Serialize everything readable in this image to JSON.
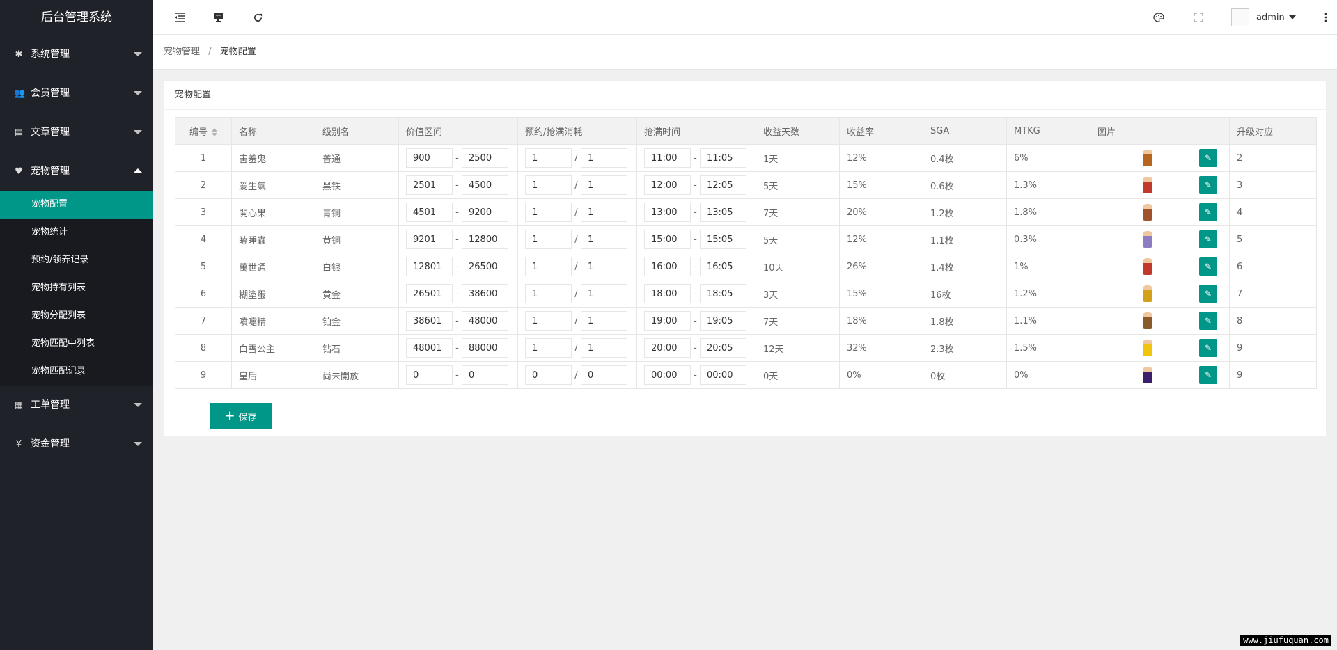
{
  "app_title": "后台管理系统",
  "sidebar": {
    "groups": [
      {
        "label": "系统管理",
        "icon": "gear-icon",
        "glyph": "✱"
      },
      {
        "label": "会员管理",
        "icon": "users-icon",
        "glyph": "👥"
      },
      {
        "label": "文章管理",
        "icon": "copy-icon",
        "glyph": "▤"
      },
      {
        "label": "宠物管理",
        "icon": "heart-icon",
        "glyph": "♥"
      },
      {
        "label": "工单管理",
        "icon": "file-icon",
        "glyph": "▦"
      },
      {
        "label": "资金管理",
        "icon": "yen-icon",
        "glyph": "¥"
      }
    ],
    "pet_sub": [
      {
        "label": "宠物配置",
        "active": true
      },
      {
        "label": "宠物统计"
      },
      {
        "label": "预约/领养记录"
      },
      {
        "label": "宠物持有列表"
      },
      {
        "label": "宠物分配列表"
      },
      {
        "label": "宠物匹配中列表"
      },
      {
        "label": "宠物匹配记录"
      }
    ]
  },
  "header": {
    "user": "admin",
    "icons": [
      "menu-shrink-icon",
      "monitor-icon",
      "refresh-icon",
      "theme-icon",
      "fullscreen-icon",
      "more-icon"
    ]
  },
  "breadcrumb": {
    "parent": "宠物管理",
    "current": "宠物配置",
    "sep": "/"
  },
  "card": {
    "title": "宠物配置"
  },
  "table": {
    "headers": [
      "编号",
      "名称",
      "级别名",
      "价值区间",
      "预约/抢满消耗",
      "抢满时间",
      "收益天数",
      "收益率",
      "SGA",
      "MTKG",
      "图片",
      "升级对应"
    ],
    "rows": [
      {
        "id": "1",
        "name": "害羞鬼",
        "level": "普通",
        "vmin": "900",
        "vmax": "2500",
        "c1": "1",
        "c2": "1",
        "t1": "11:00",
        "t2": "11:05",
        "days": "1天",
        "rate": "12%",
        "sga": "0.4枚",
        "mtkg": "6%",
        "up": "2",
        "color": "#b5651d"
      },
      {
        "id": "2",
        "name": "爱生氣",
        "level": "黑铁",
        "vmin": "2501",
        "vmax": "4500",
        "c1": "1",
        "c2": "1",
        "t1": "12:00",
        "t2": "12:05",
        "days": "5天",
        "rate": "15%",
        "sga": "0.6枚",
        "mtkg": "1.3%",
        "up": "3",
        "color": "#c0392b"
      },
      {
        "id": "3",
        "name": "開心果",
        "level": "青铜",
        "vmin": "4501",
        "vmax": "9200",
        "c1": "1",
        "c2": "1",
        "t1": "13:00",
        "t2": "13:05",
        "days": "7天",
        "rate": "20%",
        "sga": "1.2枚",
        "mtkg": "1.8%",
        "up": "4",
        "color": "#a0522d"
      },
      {
        "id": "4",
        "name": "瞌睡蟲",
        "level": "黄铜",
        "vmin": "9201",
        "vmax": "12800",
        "c1": "1",
        "c2": "1",
        "t1": "15:00",
        "t2": "15:05",
        "days": "5天",
        "rate": "12%",
        "sga": "1.1枚",
        "mtkg": "0.3%",
        "up": "5",
        "color": "#8e7cc3"
      },
      {
        "id": "5",
        "name": "萬世通",
        "level": "白银",
        "vmin": "12801",
        "vmax": "26500",
        "c1": "1",
        "c2": "1",
        "t1": "16:00",
        "t2": "16:05",
        "days": "10天",
        "rate": "26%",
        "sga": "1.4枚",
        "mtkg": "1%",
        "up": "6",
        "color": "#c0392b"
      },
      {
        "id": "6",
        "name": "糊塗蛋",
        "level": "黄金",
        "vmin": "26501",
        "vmax": "38600",
        "c1": "1",
        "c2": "1",
        "t1": "18:00",
        "t2": "18:05",
        "days": "3天",
        "rate": "15%",
        "sga": "16枚",
        "mtkg": "1.2%",
        "up": "7",
        "color": "#d4a017"
      },
      {
        "id": "7",
        "name": "噴嚏精",
        "level": "铂金",
        "vmin": "38601",
        "vmax": "48000",
        "c1": "1",
        "c2": "1",
        "t1": "19:00",
        "t2": "19:05",
        "days": "7天",
        "rate": "18%",
        "sga": "1.8枚",
        "mtkg": "1.1%",
        "up": "8",
        "color": "#8b5a2b"
      },
      {
        "id": "8",
        "name": "白雪公主",
        "level": "钻石",
        "vmin": "48001",
        "vmax": "88000",
        "c1": "1",
        "c2": "1",
        "t1": "20:00",
        "t2": "20:05",
        "days": "12天",
        "rate": "32%",
        "sga": "2.3枚",
        "mtkg": "1.5%",
        "up": "9",
        "color": "#f1c40f"
      },
      {
        "id": "9",
        "name": "皇后",
        "level": "尚未開放",
        "vmin": "0",
        "vmax": "0",
        "c1": "0",
        "c2": "0",
        "t1": "00:00",
        "t2": "00:00",
        "days": "0天",
        "rate": "0%",
        "sga": "0枚",
        "mtkg": "0%",
        "up": "9",
        "color": "#3b1f6b"
      }
    ]
  },
  "save_label": "保存",
  "watermark": "www.jiufuquan.com",
  "colors": {
    "accent": "#009688",
    "sidebar": "#20222a"
  }
}
